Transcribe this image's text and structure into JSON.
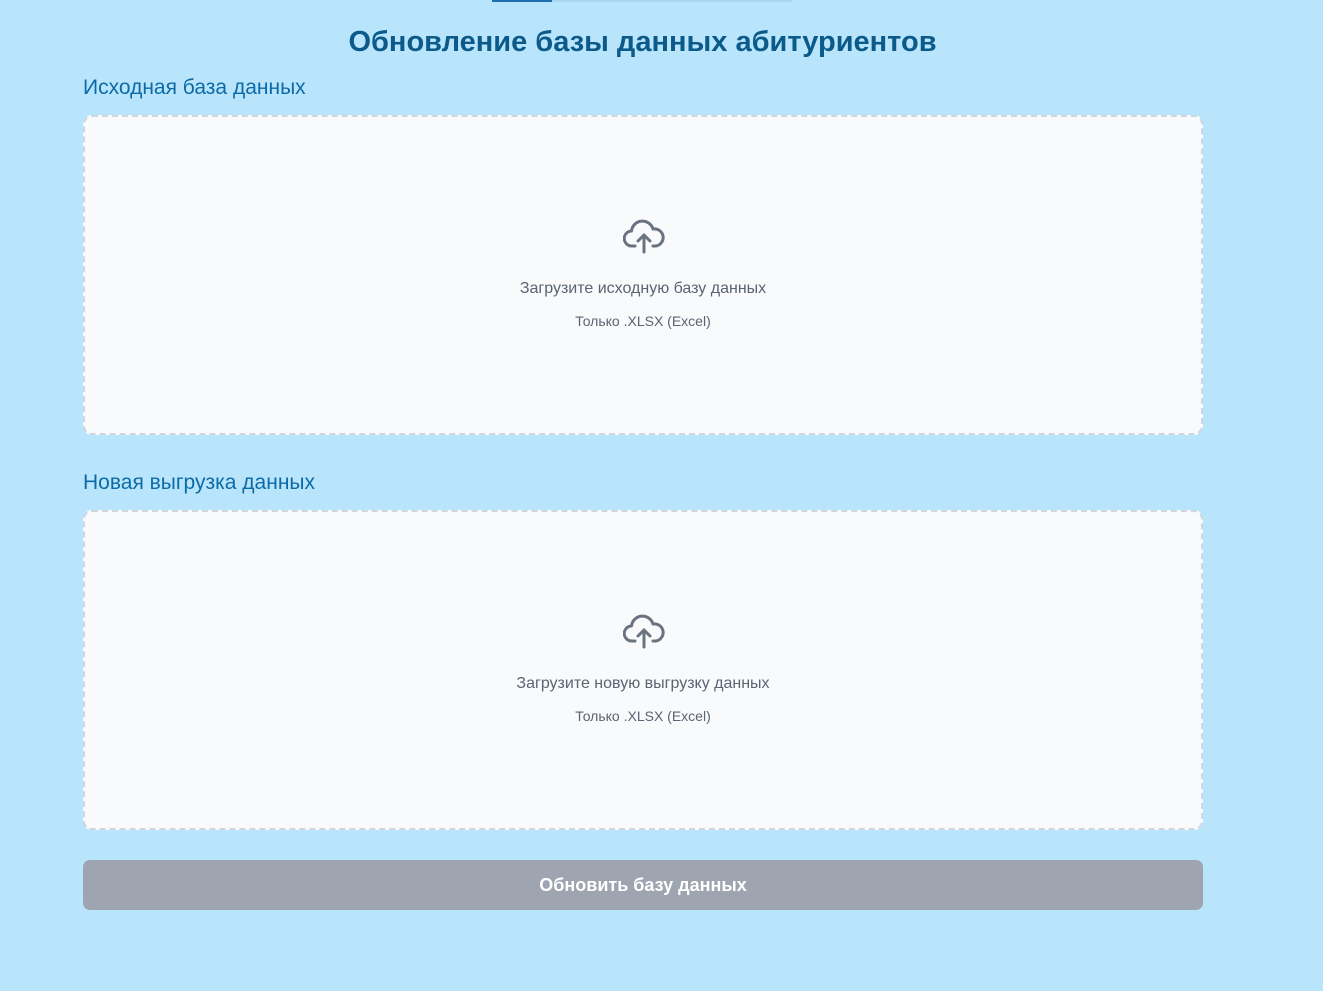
{
  "page": {
    "title": "Обновление базы данных абитуриентов"
  },
  "sections": [
    {
      "heading": "Исходная база данных",
      "dropzone": {
        "icon": "cloud-upload-icon",
        "title": "Загрузите исходную базу данных",
        "hint": "Только .XLSX (Excel)"
      }
    },
    {
      "heading": "Новая выгрузка данных",
      "dropzone": {
        "icon": "cloud-upload-icon",
        "title": "Загрузите новую выгрузку данных",
        "hint": "Только .XLSX (Excel)"
      }
    }
  ],
  "actions": {
    "submit_label": "Обновить базу данных",
    "submit_state": "disabled"
  },
  "colors": {
    "background": "#b9e5fc",
    "title": "#0b5a8a",
    "heading": "#0c6ba7",
    "dropzone_bg": "#f8fafc",
    "dropzone_border": "#cfd6de",
    "text_muted": "#5b6472",
    "button_disabled": "#9ea5b1"
  }
}
